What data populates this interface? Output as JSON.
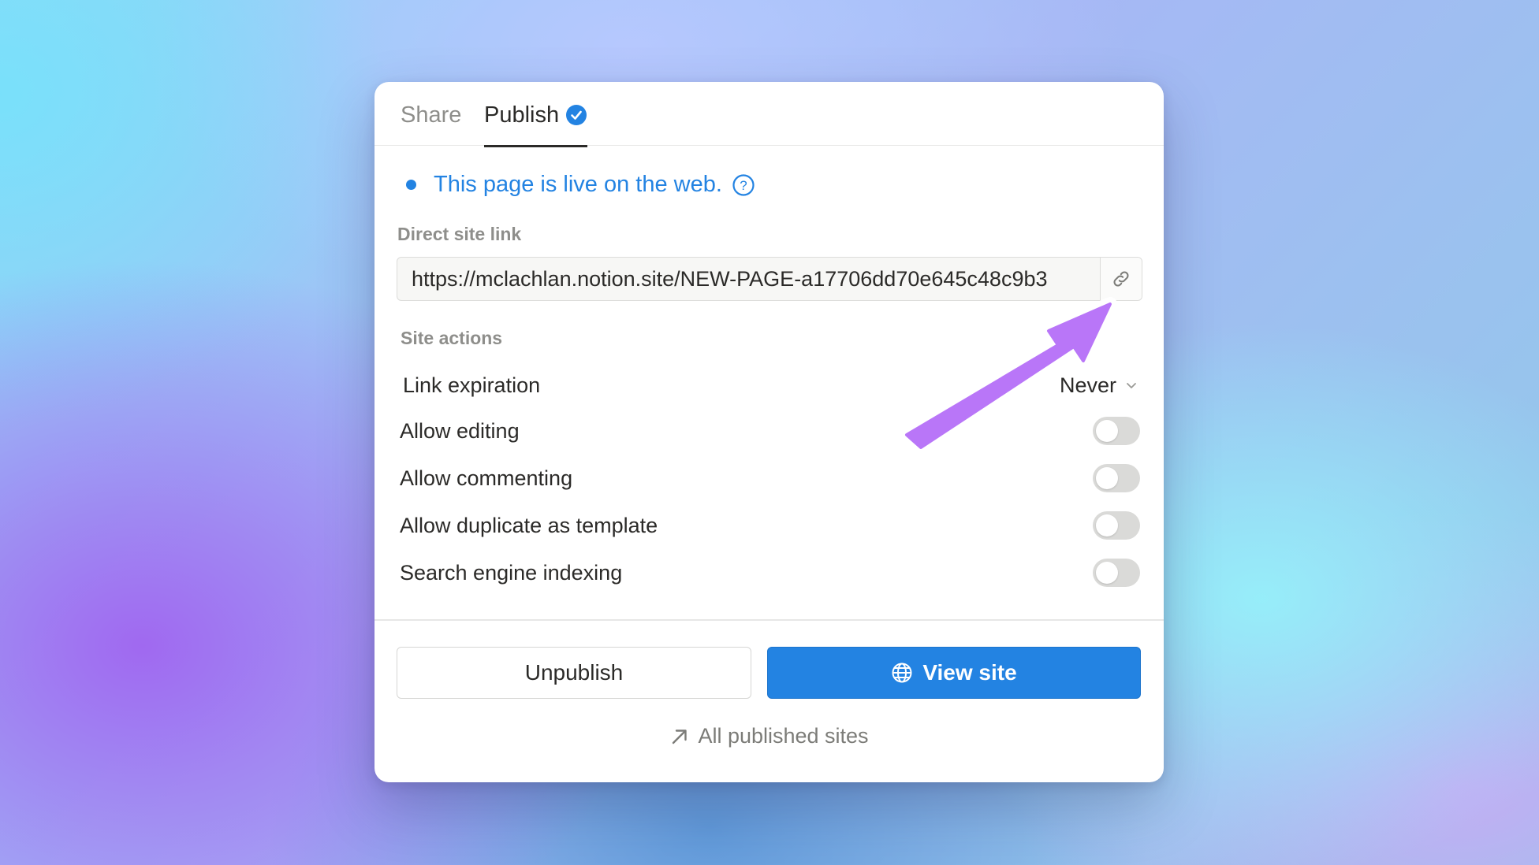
{
  "tabs": [
    {
      "label": "Share",
      "active": false
    },
    {
      "label": "Publish",
      "active": true,
      "badge_icon": "verified-check-icon"
    }
  ],
  "status": {
    "text": "This page is live on the web.",
    "help_icon": "question-circle-icon",
    "color": "#2383e2"
  },
  "direct_link": {
    "label": "Direct site link",
    "url": "https://mclachlan.notion.site/NEW-PAGE-a17706dd70e645c48c9b3",
    "copy_icon": "link-icon"
  },
  "site_actions": {
    "label": "Site actions",
    "link_expiration": {
      "label": "Link expiration",
      "value": "Never"
    },
    "toggles": [
      {
        "label": "Allow editing",
        "on": false
      },
      {
        "label": "Allow commenting",
        "on": false
      },
      {
        "label": "Allow duplicate as template",
        "on": false
      },
      {
        "label": "Search engine indexing",
        "on": false
      }
    ]
  },
  "buttons": {
    "unpublish": "Unpublish",
    "view_site": "View site",
    "view_site_icon": "globe-icon"
  },
  "footer_link": {
    "label": "All published sites",
    "icon": "arrow-up-right-icon"
  },
  "annotation": {
    "icon": "pointer-arrow-annotation",
    "color": "#b976f8"
  }
}
